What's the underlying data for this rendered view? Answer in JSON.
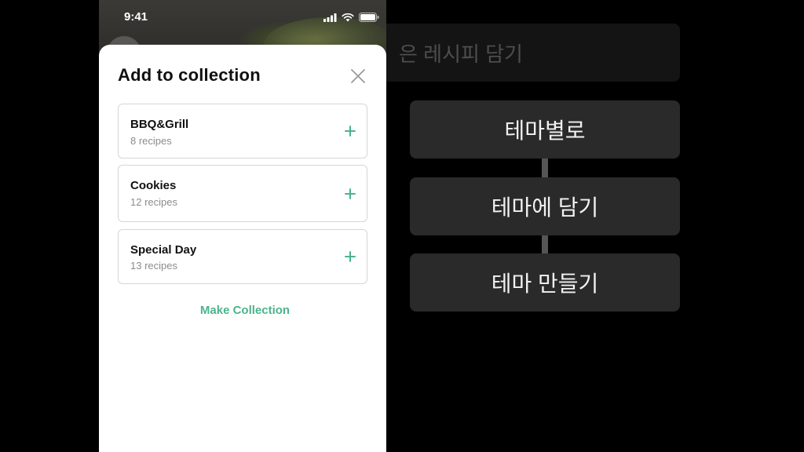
{
  "status_bar": {
    "time": "9:41",
    "icons": [
      "cellular-signal-icon",
      "wifi-icon",
      "battery-icon"
    ]
  },
  "sheet": {
    "title": "Add to collection",
    "close_icon": "close-icon",
    "collections": [
      {
        "name": "BBQ&Grill",
        "count": "8 recipes"
      },
      {
        "name": "Cookies",
        "count": "12 recipes"
      },
      {
        "name": "Special Day",
        "count": "13 recipes"
      }
    ],
    "add_icon": "plus-icon",
    "make_collection_label": "Make Collection"
  },
  "flow": {
    "top_partial": "은 레시피 담기",
    "steps": [
      "테마별로",
      "테마에 담기",
      "테마 만들기"
    ]
  },
  "colors": {
    "accent": "#4bb48c",
    "flow_box": "#2a2a2a",
    "background": "#000000"
  }
}
